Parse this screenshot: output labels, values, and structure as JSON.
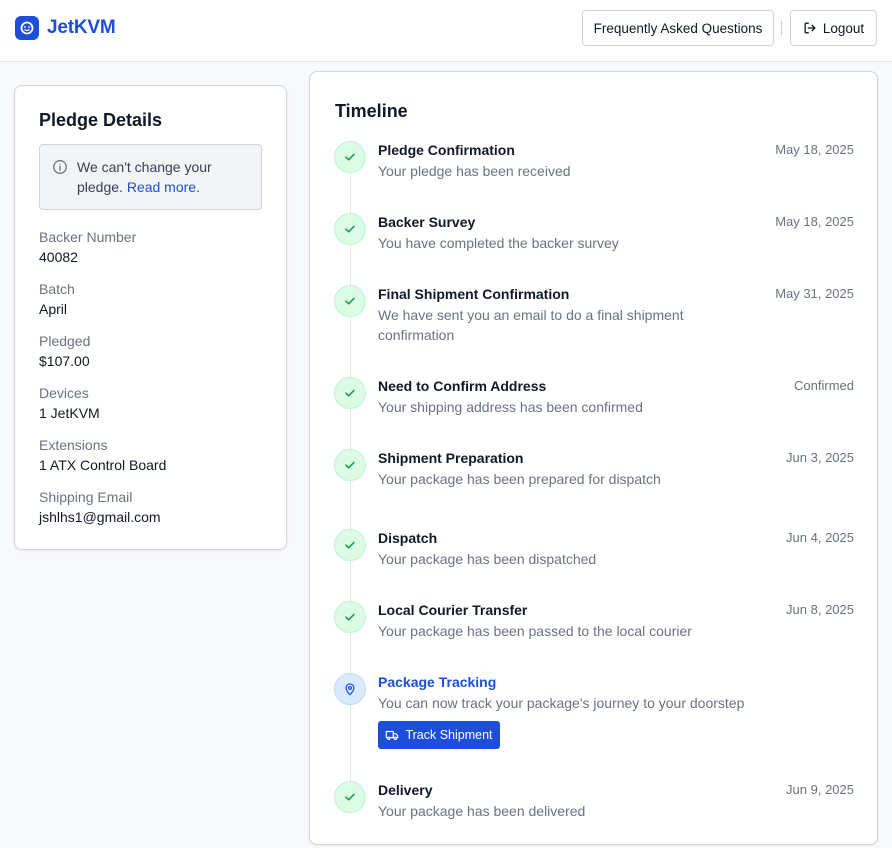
{
  "app": {
    "name": "JetKVM"
  },
  "header": {
    "faq_label": "Frequently Asked Questions",
    "logout_label": "Logout"
  },
  "pledge": {
    "title": "Pledge Details",
    "notice": {
      "text": "We can't change your pledge.",
      "link_text": "Read more",
      "suffix": "."
    },
    "details": [
      {
        "label": "Backer Number",
        "value": "40082"
      },
      {
        "label": "Batch",
        "value": "April"
      },
      {
        "label": "Pledged",
        "value": "$107.00"
      },
      {
        "label": "Devices",
        "value": "1 JetKVM"
      },
      {
        "label": "Extensions",
        "value": "1 ATX Control Board"
      },
      {
        "label": "Shipping Email",
        "value": "jshlhs1@gmail.com"
      }
    ]
  },
  "timeline": {
    "title": "Timeline",
    "items": [
      {
        "name": "Pledge Confirmation",
        "desc": "Your pledge has been received",
        "date": "May 18, 2025",
        "icon": "check-icon"
      },
      {
        "name": "Backer Survey",
        "desc": "You have completed the backer survey",
        "date": "May 18, 2025",
        "icon": "check-icon"
      },
      {
        "name": "Final Shipment Confirmation",
        "desc": "We have sent you an email to do a final shipment confirmation",
        "date": "May 31, 2025",
        "icon": "check-icon"
      },
      {
        "name": "Need to Confirm Address",
        "desc": "Your shipping address has been confirmed",
        "date": "Confirmed",
        "icon": "check-icon"
      },
      {
        "name": "Shipment Preparation",
        "desc": "Your package has been prepared for dispatch",
        "date": "Jun 3, 2025",
        "icon": "check-icon"
      },
      {
        "name": "Dispatch",
        "desc": "Your package has been dispatched",
        "date": "Jun 4, 2025",
        "icon": "check-icon"
      },
      {
        "name": "Local Courier Transfer",
        "desc": "Your package has been passed to the local courier",
        "date": "Jun 8, 2025",
        "icon": "check-icon"
      },
      {
        "name": "Package Tracking",
        "desc": "You can now track your package's journey to your doorstep",
        "date": "",
        "icon": "map-pin-icon",
        "button": "Track Shipment"
      },
      {
        "name": "Delivery",
        "desc": "Your package has been delivered",
        "date": "Jun 9, 2025",
        "icon": "check-icon"
      }
    ]
  },
  "colors": {
    "brand": "#1d4ed8",
    "success_bg": "#dcfce7",
    "success": "#16a34a"
  }
}
